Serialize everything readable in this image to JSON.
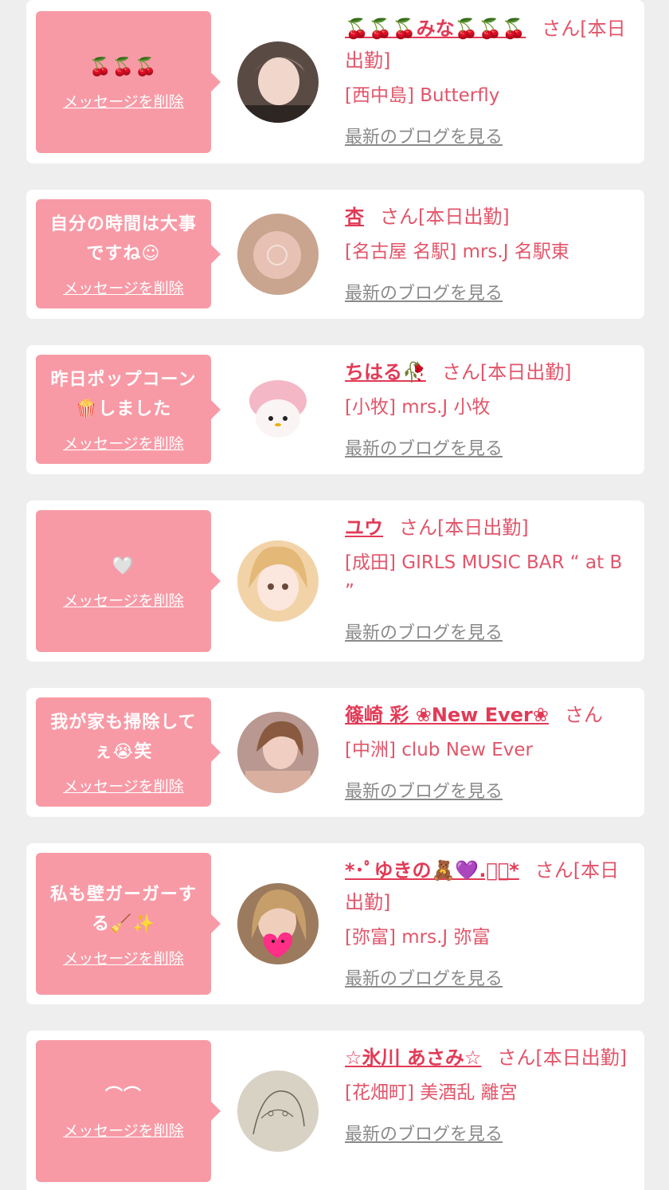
{
  "items": [
    {
      "message": "🍒🍒🍒",
      "delete_label": "メッセージを削除",
      "name": "🍒🍒🍒みな🍒🍒🍒",
      "suffix": "さん[本日出勤]",
      "shop": "[西中島] Butterfly",
      "blog_label": "最新のブログを見る",
      "avatar": "woman-selfie-photo"
    },
    {
      "message": "自分の時間は大事\nですね☺",
      "delete_label": "メッセージを削除",
      "name": "杏",
      "suffix": "さん[本日出勤]",
      "shop": "[名古屋 名駅] mrs.J 名駅東",
      "blog_label": "最新のブログを見る",
      "avatar": "blurred-woman-photo"
    },
    {
      "message": "昨日ポップコーン\n🍿しました",
      "delete_label": "メッセージを削除",
      "name": "ちはる🥀",
      "suffix": "さん[本日出勤]",
      "shop": "[小牧] mrs.J 小牧",
      "blog_label": "最新のブログを見る",
      "avatar": "plush-toy-photo"
    },
    {
      "message": "🤍",
      "delete_label": "メッセージを削除",
      "name": "ユウ",
      "suffix": "さん[本日出勤]",
      "shop": "[成田] GIRLS MUSIC BAR “ at B ”",
      "blog_label": "最新のブログを見る",
      "avatar": "blonde-woman-photo"
    },
    {
      "message": "我が家も掃除して\nぇ😭笑",
      "delete_label": "メッセージを削除",
      "name": "篠崎 彩 ❀New Ever❀",
      "suffix": "さん",
      "shop": "[中洲] club New Ever",
      "blog_label": "最新のブログを見る",
      "avatar": "woman-photo"
    },
    {
      "message": "私も壁ガーガーす\nる🧹✨",
      "delete_label": "メッセージを削除",
      "name": "*･ﾟゆきの🧸💜.ﾟ･*",
      "suffix": "さん[本日出勤]",
      "shop": "[弥富] mrs.J 弥富",
      "blog_label": "最新のブログを見る",
      "avatar": "woman-heart-sticker-photo"
    },
    {
      "message": "⌒⌒",
      "delete_label": "メッセージを削除",
      "name": "☆氷川 あさみ☆",
      "suffix": "さん[本日出勤]",
      "shop": "[花畑町] 美酒乱 離宮",
      "blog_label": "最新のブログを見る",
      "avatar": "sketch-drawing-photo"
    }
  ],
  "colors": {
    "background": "#eeeeee",
    "card": "#ffffff",
    "bubble": "#f89aa6",
    "name": "#e23a56",
    "text_pink": "#e2556a",
    "link_gray": "#8a8a8a"
  }
}
